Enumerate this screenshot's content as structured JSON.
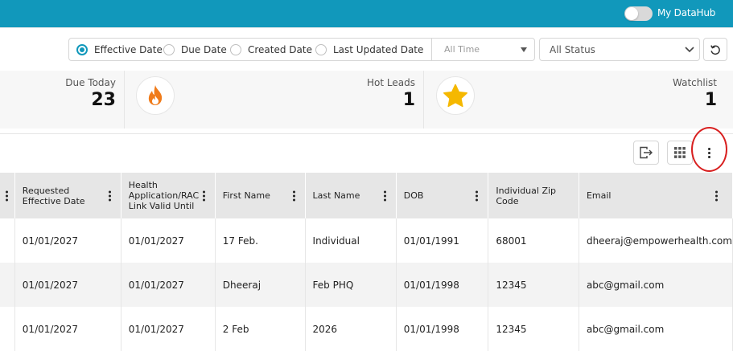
{
  "header": {
    "toggle_label": "My DataHub"
  },
  "filters": {
    "date_options": [
      {
        "label": "Effective Date",
        "selected": true
      },
      {
        "label": "Due Date",
        "selected": false
      },
      {
        "label": "Created Date",
        "selected": false
      },
      {
        "label": "Last Updated Date",
        "selected": false
      }
    ],
    "time_range": "All Time",
    "status": "All Status"
  },
  "stats": {
    "due_today": {
      "label": "Due Today",
      "value": "23"
    },
    "hot_leads": {
      "label": "Hot Leads",
      "value": "1"
    },
    "watchlist": {
      "label": "Watchlist",
      "value": "1"
    }
  },
  "table": {
    "columns": [
      "Requested Effective Date",
      "Health Application/RAC Link Valid Until",
      "First Name",
      "Last Name",
      "DOB",
      "Individual Zip Code",
      "Email"
    ],
    "rows": [
      [
        "01/01/2027",
        "01/01/2027",
        "17 Feb.",
        "Individual",
        "01/01/1991",
        "68001",
        "dheeraj@empowerhealth.com"
      ],
      [
        "01/01/2027",
        "01/01/2027",
        "Dheeraj",
        "Feb PHQ",
        "01/01/1998",
        "12345",
        "abc@gmail.com"
      ],
      [
        "01/01/2027",
        "01/01/2027",
        "2 Feb",
        "2026",
        "01/01/1998",
        "12345",
        "abc@gmail.com"
      ]
    ]
  },
  "colors": {
    "brand": "#1198bb",
    "fire": "#f07b1a",
    "star": "#f5b800",
    "highlight": "#d82020"
  }
}
